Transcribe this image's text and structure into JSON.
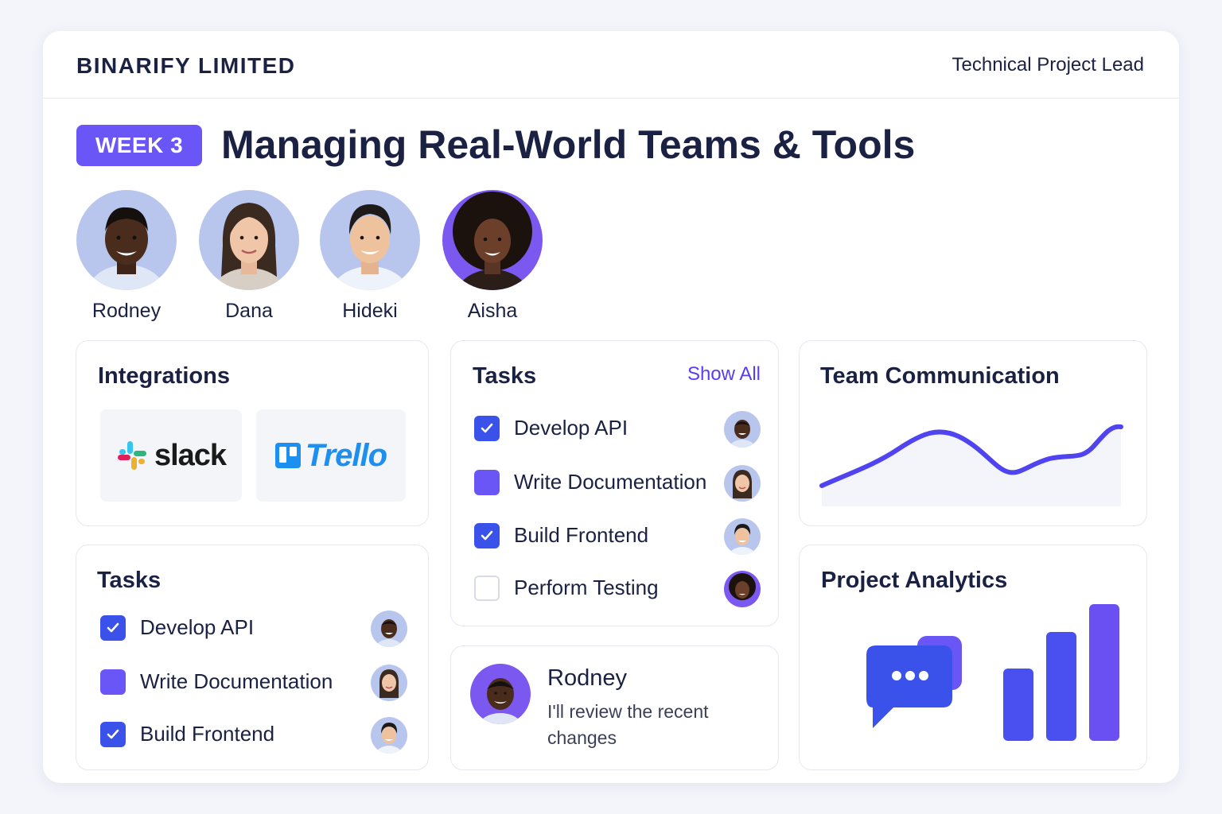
{
  "header": {
    "company": "BINARIFY LIMITED",
    "role": "Technical Project Lead"
  },
  "hero": {
    "badge": "WEEK 3",
    "title": "Managing Real-World Teams & Tools"
  },
  "team": [
    {
      "name": "Rodney",
      "active": false
    },
    {
      "name": "Dana",
      "active": false
    },
    {
      "name": "Hideki",
      "active": false
    },
    {
      "name": "Aisha",
      "active": true
    }
  ],
  "integrations": {
    "title": "Integrations",
    "items": [
      {
        "name": "slack",
        "icon": "slack-logo-icon"
      },
      {
        "name": "Trello",
        "icon": "trello-logo-icon"
      }
    ]
  },
  "tasks_main": {
    "title": "Tasks",
    "show_all": "Show All",
    "items": [
      {
        "label": "Develop API",
        "state": "checked",
        "assignee": "Rodney"
      },
      {
        "label": "Write Documentation",
        "state": "filled",
        "assignee": "Dana"
      },
      {
        "label": "Build Frontend",
        "state": "checked",
        "assignee": "Hideki"
      },
      {
        "label": "Perform Testing",
        "state": "empty",
        "assignee": "Aisha"
      }
    ]
  },
  "tasks_secondary": {
    "title": "Tasks",
    "items": [
      {
        "label": "Develop API",
        "state": "checked",
        "assignee": "Rodney"
      },
      {
        "label": "Write Documentation",
        "state": "filled",
        "assignee": "Dana"
      },
      {
        "label": "Build Frontend",
        "state": "checked",
        "assignee": "Hideki"
      }
    ]
  },
  "message": {
    "author": "Rodney",
    "text": "I'll review the recent changes"
  },
  "team_communication": {
    "title": "Team Communication"
  },
  "project_analytics": {
    "title": "Project Analytics",
    "bars": [
      0.39,
      0.59,
      0.74
    ]
  },
  "colors": {
    "accent": "#6a55f6",
    "primary": "#3b52ea",
    "link": "#5a3df0",
    "text": "#1b2143"
  }
}
